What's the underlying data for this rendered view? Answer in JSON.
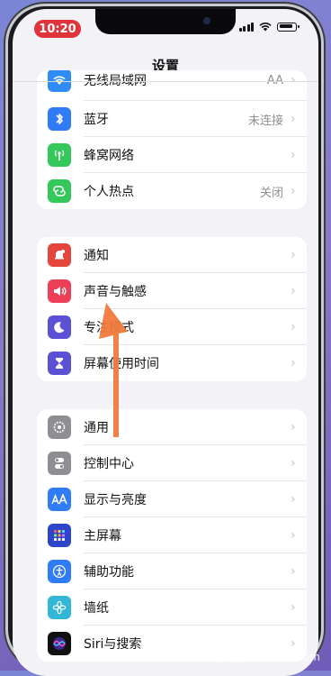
{
  "status": {
    "time": "10:20"
  },
  "nav": {
    "title": "设置"
  },
  "groups": [
    {
      "rows": [
        {
          "label": "无线局域网",
          "value": "AA",
          "color": "#2f8cf7"
        },
        {
          "label": "蓝牙",
          "value": "未连接",
          "color": "#2f7cf6"
        },
        {
          "label": "蜂窝网络",
          "value": "",
          "color": "#34c759"
        },
        {
          "label": "个人热点",
          "value": "关闭",
          "color": "#34c759"
        }
      ]
    },
    {
      "rows": [
        {
          "label": "通知",
          "value": "",
          "color": "#e5463b"
        },
        {
          "label": "声音与触感",
          "value": "",
          "color": "#ee3f59"
        },
        {
          "label": "专注模式",
          "value": "",
          "color": "#5a51d5"
        },
        {
          "label": "屏幕使用时间",
          "value": "",
          "color": "#5a51d5"
        }
      ]
    },
    {
      "rows": [
        {
          "label": "通用",
          "value": "",
          "color": "#8e8e93"
        },
        {
          "label": "控制中心",
          "value": "",
          "color": "#8e8e93"
        },
        {
          "label": "显示与亮度",
          "value": "",
          "color": "#2f7cf6"
        },
        {
          "label": "主屏幕",
          "value": "",
          "color": "#2f45c9"
        },
        {
          "label": "辅助功能",
          "value": "",
          "color": "#2f7cf6"
        },
        {
          "label": "墙纸",
          "value": "",
          "color": "#34b7d6"
        },
        {
          "label": "Siri与搜索",
          "value": "",
          "color": "#222"
        }
      ]
    }
  ],
  "watermark": "jingyan.baidu.com"
}
